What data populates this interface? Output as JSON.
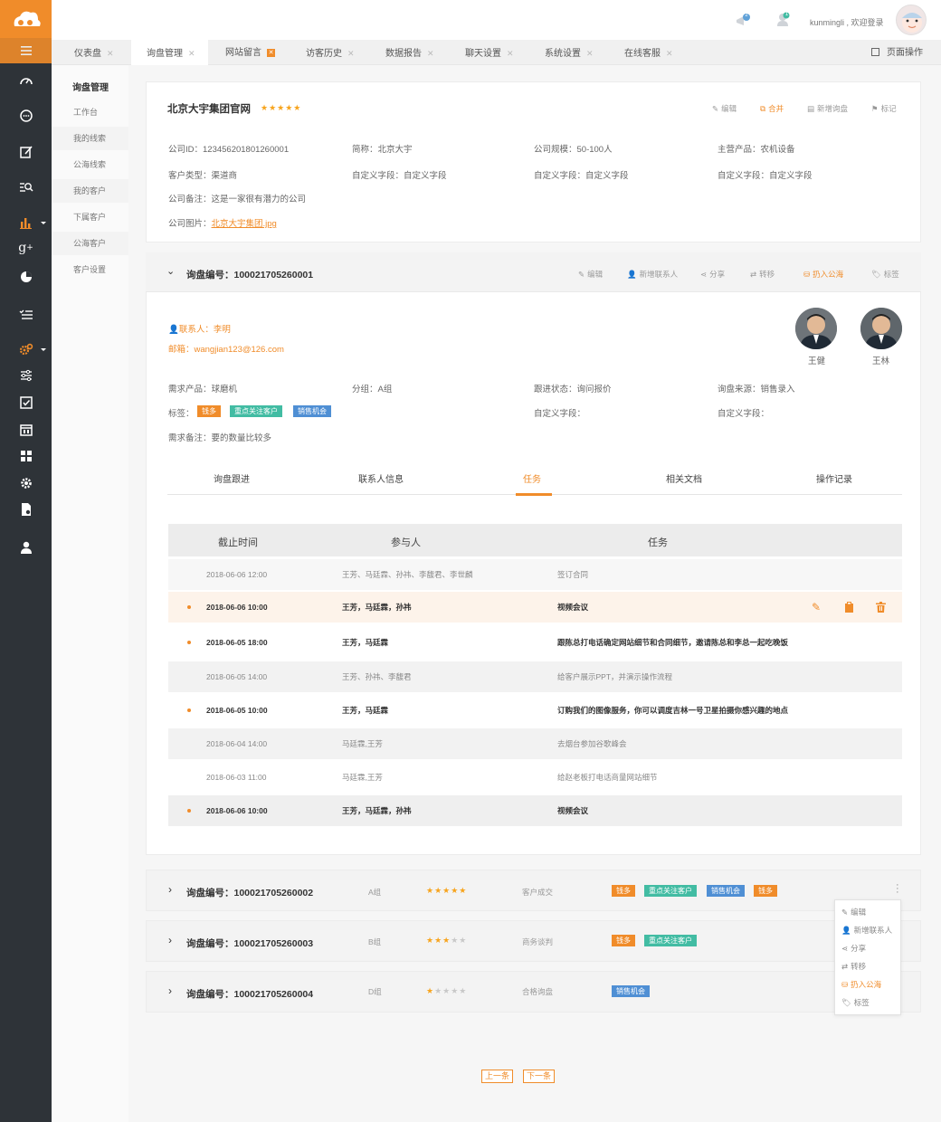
{
  "header": {
    "username": "kunmingli , 欢迎登录",
    "notif_badge": "2",
    "user_badge": "1"
  },
  "tabs": [
    {
      "label": "仪表盘"
    },
    {
      "label": "询盘管理"
    },
    {
      "label": "网站留言"
    },
    {
      "label": "访客历史"
    },
    {
      "label": "数据报告"
    },
    {
      "label": "聊天设置"
    },
    {
      "label": "系统设置"
    },
    {
      "label": "在线客服"
    }
  ],
  "page_actions": "页面操作",
  "submenu": {
    "title": "询盘管理",
    "items": [
      "工作台",
      "我的线索",
      "公海线索",
      "我的客户",
      "下属客户",
      "公海客户",
      "客户设置"
    ]
  },
  "company": {
    "name": "北京大宇集团官网",
    "stars": "★★★★★",
    "actions": {
      "edit": "编辑",
      "merge": "合并",
      "new_inquiry": "新增询盘",
      "mark": "标记"
    },
    "fields": {
      "id": "公司ID：123456201801260001",
      "short": "简称：北京大宇",
      "size": "公司规模：50-100人",
      "product": "主营产品：农机设备",
      "type": "客户类型：渠道商",
      "custom1": "自定义字段：自定义字段",
      "custom2": "自定义字段：自定义字段",
      "custom3": "自定义字段：自定义字段",
      "note": "公司备注：这是一家很有潜力的公司",
      "image_label": "公司图片：",
      "image_link": "北京大宇集团.jpg"
    }
  },
  "inquiry_main": {
    "number": "询盘编号：100021705260001",
    "actions": {
      "edit": "编辑",
      "add_contact": "新增联系人",
      "share": "分享",
      "transfer": "转移",
      "to_pool": "扔入公海",
      "tag": "标签"
    },
    "contact": "联系人：李明",
    "email": "邮箱：wangjian123@126.com",
    "people": [
      {
        "name": "王健"
      },
      {
        "name": "王林"
      }
    ],
    "fields": {
      "product": "需求产品：球磨机",
      "group": "分组：A组",
      "status": "跟进状态：询问报价",
      "source": "询盘来源：销售录入",
      "tag_label": "标签：",
      "custom1": "自定义字段：",
      "custom2": "自定义字段：",
      "note": "需求备注：要的数量比较多"
    },
    "tags": [
      "钱多",
      "重点关注客户",
      "销售机会"
    ],
    "detail_tabs": [
      "询盘跟进",
      "联系人信息",
      "任务",
      "相关文档",
      "操作记录"
    ],
    "active_tab": "任务",
    "table": {
      "headers": [
        "截止时间",
        "参与人",
        "任务"
      ],
      "rows": [
        {
          "date": "2018-06-06  12:00",
          "people": "王芳、马廷霖、孙祎、李馥君、李世麟",
          "task": "签订合同",
          "bold": false
        },
        {
          "date": "2018-06-06  10:00",
          "people": "王芳，马廷霖，孙祎",
          "task": "视频会议",
          "bold": true
        },
        {
          "date": "2018-06-05  18:00",
          "people": "王芳，马廷霖",
          "task": "跟陈总打电话确定网站细节和合同细节，邀请陈总和李总一起吃晚饭",
          "bold": true
        },
        {
          "date": "2018-06-05  14:00",
          "people": "王芳、孙祎、李馥君",
          "task": "给客户展示PPT，并演示操作流程",
          "bold": false
        },
        {
          "date": "2018-06-05  10:00",
          "people": "王芳，马廷霖",
          "task": "订购我们的图像服务，你可以调度吉林一号卫星拍摄你感兴趣的地点",
          "bold": true
        },
        {
          "date": "2018-06-04  14:00",
          "people": "马廷霖,王芳",
          "task": "去烟台参加谷歌峰会",
          "bold": false
        },
        {
          "date": "2018-06-03  11:00",
          "people": "马廷霖,王芳",
          "task": "给赵老板打电话商量网站细节",
          "bold": false
        },
        {
          "date": "2018-06-06  10:00",
          "people": "王芳，马廷霖，孙祎",
          "task": "视频会议",
          "bold": true
        }
      ]
    }
  },
  "inquiries": [
    {
      "number": "询盘编号：100021705260002",
      "group": "A组",
      "stars": "★★★★★",
      "status": "客户成交",
      "tags": [
        "钱多",
        "重点关注客户",
        "销售机会",
        "钱多"
      ]
    },
    {
      "number": "询盘编号：100021705260003",
      "group": "B组",
      "stars": "★★★★★",
      "status": "商务谈判",
      "tags": [
        "钱多",
        "重点关注客户"
      ]
    },
    {
      "number": "询盘编号：100021705260004",
      "group": "D组",
      "stars": "★★★★★",
      "status": "合格询盘",
      "tags": [
        "销售机会"
      ]
    }
  ],
  "popup_menu": [
    "编辑",
    "新增联系人",
    "分享",
    "转移",
    "扔入公海",
    "标签"
  ],
  "pagination": {
    "prev": "上一条",
    "next": "下一条"
  },
  "colors": {
    "accent": "#f08c2a",
    "sidebar": "#2e3338",
    "tag_green": "#42bca3",
    "tag_blue": "#4f8fd4",
    "star": "#f7a41d"
  }
}
